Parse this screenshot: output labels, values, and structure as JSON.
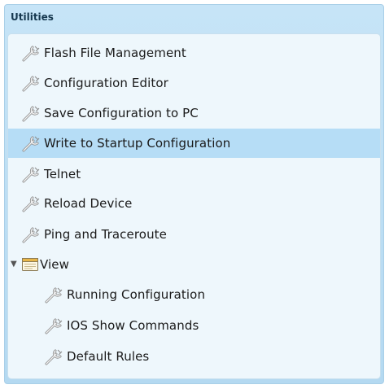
{
  "panel": {
    "title": "Utilities"
  },
  "items": [
    {
      "label": "Flash File Management"
    },
    {
      "label": "Configuration Editor"
    },
    {
      "label": "Save Configuration to PC"
    },
    {
      "label": "Write to Startup Configuration",
      "selected": true
    },
    {
      "label": "Telnet"
    },
    {
      "label": "Reload Device"
    },
    {
      "label": "Ping and Traceroute"
    }
  ],
  "view_group": {
    "label": "View",
    "expanded": true,
    "icon": "folder-window-icon",
    "children": [
      {
        "label": "Running Configuration"
      },
      {
        "label": "IOS Show Commands"
      },
      {
        "label": "Default Rules"
      }
    ]
  },
  "icons": {
    "item": "wrench-icon",
    "expander": "triangle-down-icon"
  },
  "colors": {
    "selected_row": "#b6ddf6",
    "panel_header": "#c6e4f7",
    "list_bg": "#eef7fc"
  }
}
